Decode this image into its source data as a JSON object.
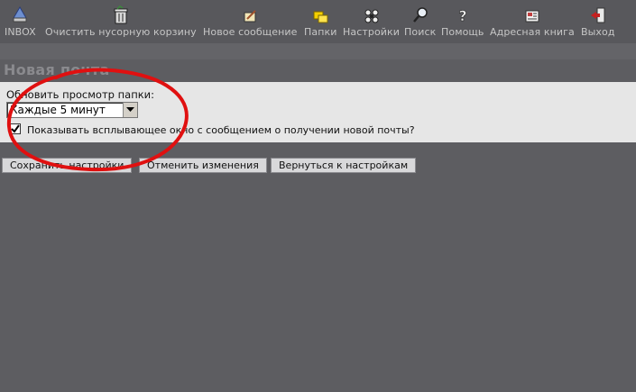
{
  "toolbar": {
    "items": [
      {
        "label": "INBOX",
        "icon": "inbox-icon"
      },
      {
        "label": "Очистить нусорную корзину",
        "icon": "trash-icon"
      },
      {
        "label": "Новое сообщение",
        "icon": "compose-icon"
      },
      {
        "label": "Папки",
        "icon": "folders-icon"
      },
      {
        "label": "Настройки",
        "icon": "settings-icon"
      },
      {
        "label": "Поиск",
        "icon": "search-icon"
      },
      {
        "label": "Помощь",
        "icon": "help-icon"
      },
      {
        "label": "Адресная книга",
        "icon": "address-book-icon"
      },
      {
        "label": "Выход",
        "icon": "logout-icon"
      }
    ]
  },
  "section": {
    "title": "Новая почта",
    "refresh_label": "Обновить просмотр папки:",
    "refresh_value": "Каждые 5 минут",
    "popup_checked": true,
    "popup_label": "Показывать всплывающее окно с сообщением о получении новой почты?"
  },
  "actions": {
    "save": "Сохранить настройки",
    "cancel": "Отменить изменения",
    "back": "Вернуться к настройкам"
  },
  "colors": {
    "background": "#5d5d61",
    "panel": "#e6e6e6",
    "annotation": "#e01010"
  }
}
